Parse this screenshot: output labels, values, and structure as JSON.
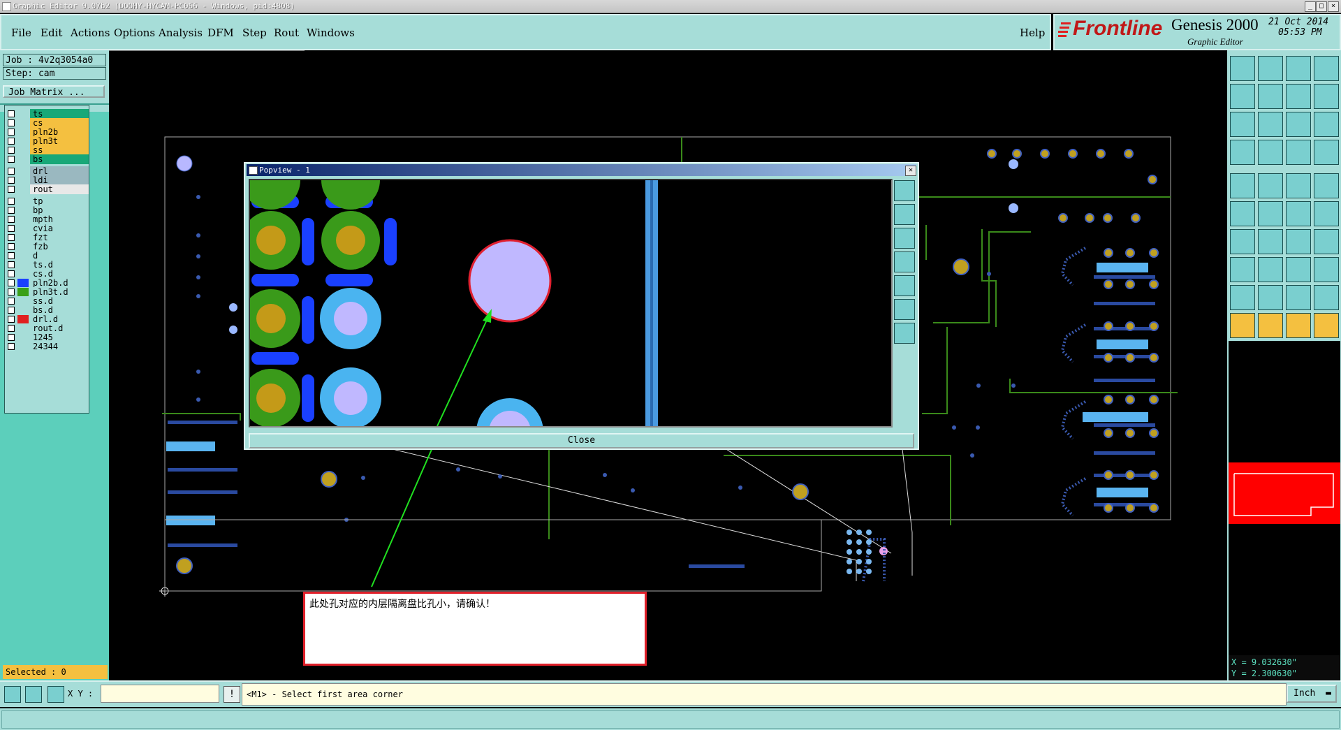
{
  "titlebar": {
    "title": "Graphic Editor 9.07b2 (DOOHY-HYCAM-PC066 - Windows, pid:4808)",
    "minimize": "_",
    "restore": "□",
    "close": "×"
  },
  "menu": {
    "items": [
      "File",
      "Edit",
      "Actions",
      "Options",
      "Analysis",
      "DFM",
      "Step",
      "Rout",
      "Windows"
    ],
    "help": "Help"
  },
  "brand": {
    "logo": "Frontline",
    "product": "Genesis 2000",
    "subtitle": "Graphic Editor",
    "date": "21 Oct 2014",
    "time": "05:53 PM"
  },
  "job": {
    "job_label": "Job : 4v2q3054a0",
    "step_label": "Step: cam",
    "matrix_button": "Job Matrix ..."
  },
  "layers": [
    {
      "name": "ts",
      "color": "#18a878"
    },
    {
      "name": "cs",
      "color": "#f4c040"
    },
    {
      "name": "pln2b",
      "color": "#f4c040"
    },
    {
      "name": "pln3t",
      "color": "#f4c040"
    },
    {
      "name": "ss",
      "color": "#f4c040"
    },
    {
      "name": "bs",
      "color": "#18a878"
    },
    {
      "name": "drl",
      "color": "#9ab8c0"
    },
    {
      "name": "ldi",
      "color": "#9ab8c0"
    },
    {
      "name": "rout",
      "color": "#e8e8e8"
    },
    {
      "name": "tp",
      "color": "#a6ddd8"
    },
    {
      "name": "bp",
      "color": "#a6ddd8"
    },
    {
      "name": "mpth",
      "color": "#a6ddd8"
    },
    {
      "name": "cvia",
      "color": "#a6ddd8"
    },
    {
      "name": "fzt",
      "color": "#a6ddd8"
    },
    {
      "name": "fzb",
      "color": "#a6ddd8"
    },
    {
      "name": "d",
      "color": "#a6ddd8"
    },
    {
      "name": "ts.d",
      "color": "#a6ddd8"
    },
    {
      "name": "cs.d",
      "color": "#a6ddd8"
    },
    {
      "name": "pln2b.d",
      "color": "#a6ddd8",
      "swatch": "#1a40ff"
    },
    {
      "name": "pln3t.d",
      "color": "#a6ddd8",
      "swatch": "#3aa018"
    },
    {
      "name": "ss.d",
      "color": "#a6ddd8"
    },
    {
      "name": "bs.d",
      "color": "#a6ddd8"
    },
    {
      "name": "drl.d",
      "color": "#a6ddd8",
      "swatch": "#e02020"
    },
    {
      "name": "rout.d",
      "color": "#a6ddd8"
    },
    {
      "name": "1245",
      "color": "#a6ddd8"
    },
    {
      "name": "24344",
      "color": "#a6ddd8"
    }
  ],
  "selected_label": "Selected : 0",
  "popview": {
    "title": "Popview - 1",
    "close_button": "Close"
  },
  "annotation": {
    "text": "此处孔对应的内层隔离盘比孔小，请确认！"
  },
  "status": {
    "xy_label": "X Y :",
    "xy_value": "",
    "message": "<M1> - Select first area corner",
    "units": "Inch"
  },
  "coords": {
    "x": "X = 9.032630\"",
    "y": "Y = 2.300630\""
  },
  "colors": {
    "panel": "#a6ddd8",
    "accent": "#5ccfbb",
    "highlight": "#f4c040",
    "alert": "#e0202a"
  }
}
